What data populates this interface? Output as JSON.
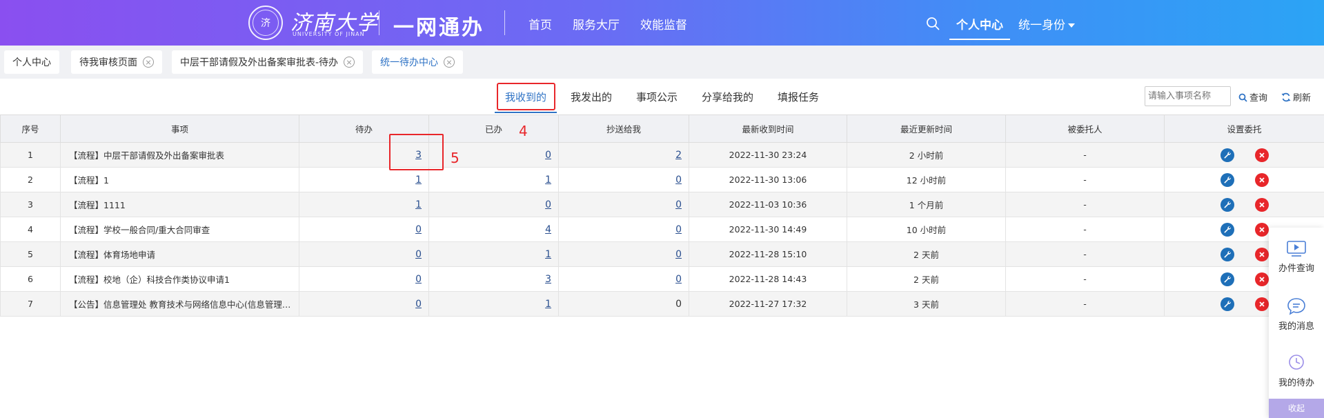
{
  "header": {
    "logo_seal": "济",
    "logo_cn": "济南大学",
    "logo_en": "UNIVERSITY OF JINAN",
    "app_title": "一网通办",
    "nav": [
      "首页",
      "服务大厅",
      "效能监督"
    ],
    "personal_center": "个人中心",
    "identity": "统一身份"
  },
  "page_tabs": [
    {
      "label": "个人中心",
      "closable": false
    },
    {
      "label": "待我审核页面",
      "closable": true
    },
    {
      "label": "中层干部请假及外出备案审批表-待办",
      "closable": true
    },
    {
      "label": "统一待办中心",
      "closable": true
    }
  ],
  "sub_tabs": [
    "我收到的",
    "我发出的",
    "事项公示",
    "分享给我的",
    "填报任务"
  ],
  "search": {
    "placeholder": "请输入事项名称",
    "query_label": "查询",
    "refresh_label": "刷新"
  },
  "annotations": {
    "a4": "4",
    "a5": "5"
  },
  "table": {
    "headers": [
      "序号",
      "事项",
      "待办",
      "已办",
      "抄送给我",
      "最新收到时间",
      "最近更新时间",
      "被委托人",
      "设置委托"
    ],
    "rows": [
      {
        "no": "1",
        "item": "【流程】中层干部请假及外出备案审批表",
        "todo": "3",
        "done": "0",
        "cc": "2",
        "received": "2022-11-30 23:24",
        "updated": "2 小时前",
        "delegate": "-"
      },
      {
        "no": "2",
        "item": "【流程】1",
        "todo": "1",
        "done": "1",
        "cc": "0",
        "received": "2022-11-30 13:06",
        "updated": "12 小时前",
        "delegate": "-"
      },
      {
        "no": "3",
        "item": "【流程】1111",
        "todo": "1",
        "done": "0",
        "cc": "0",
        "received": "2022-11-03 10:36",
        "updated": "1 个月前",
        "delegate": "-"
      },
      {
        "no": "4",
        "item": "【流程】学校一般合同/重大合同审查",
        "todo": "0",
        "done": "4",
        "cc": "0",
        "received": "2022-11-30 14:49",
        "updated": "10 小时前",
        "delegate": "-"
      },
      {
        "no": "5",
        "item": "【流程】体育场地申请",
        "todo": "0",
        "done": "1",
        "cc": "0",
        "received": "2022-11-28 15:10",
        "updated": "2 天前",
        "delegate": "-"
      },
      {
        "no": "6",
        "item": "【流程】校地（企）科技合作类协议申请1",
        "todo": "0",
        "done": "3",
        "cc": "0",
        "received": "2022-11-28 14:43",
        "updated": "2 天前",
        "delegate": "-"
      },
      {
        "no": "7",
        "item": "【公告】信息管理处 教育技术与网络信息中心(信息管理处 ...",
        "todo": "0",
        "done": "1",
        "cc": "0",
        "received": "2022-11-27 17:32",
        "updated": "3 天前",
        "delegate": "-"
      }
    ]
  },
  "float_panel": {
    "items": [
      "办件查询",
      "我的消息",
      "我的待办"
    ],
    "collapse": "收起"
  },
  "colors": {
    "accent": "#2f73c5",
    "annotation": "#e8262a",
    "wrench": "#1e6fb8",
    "delete": "#e8262a"
  }
}
